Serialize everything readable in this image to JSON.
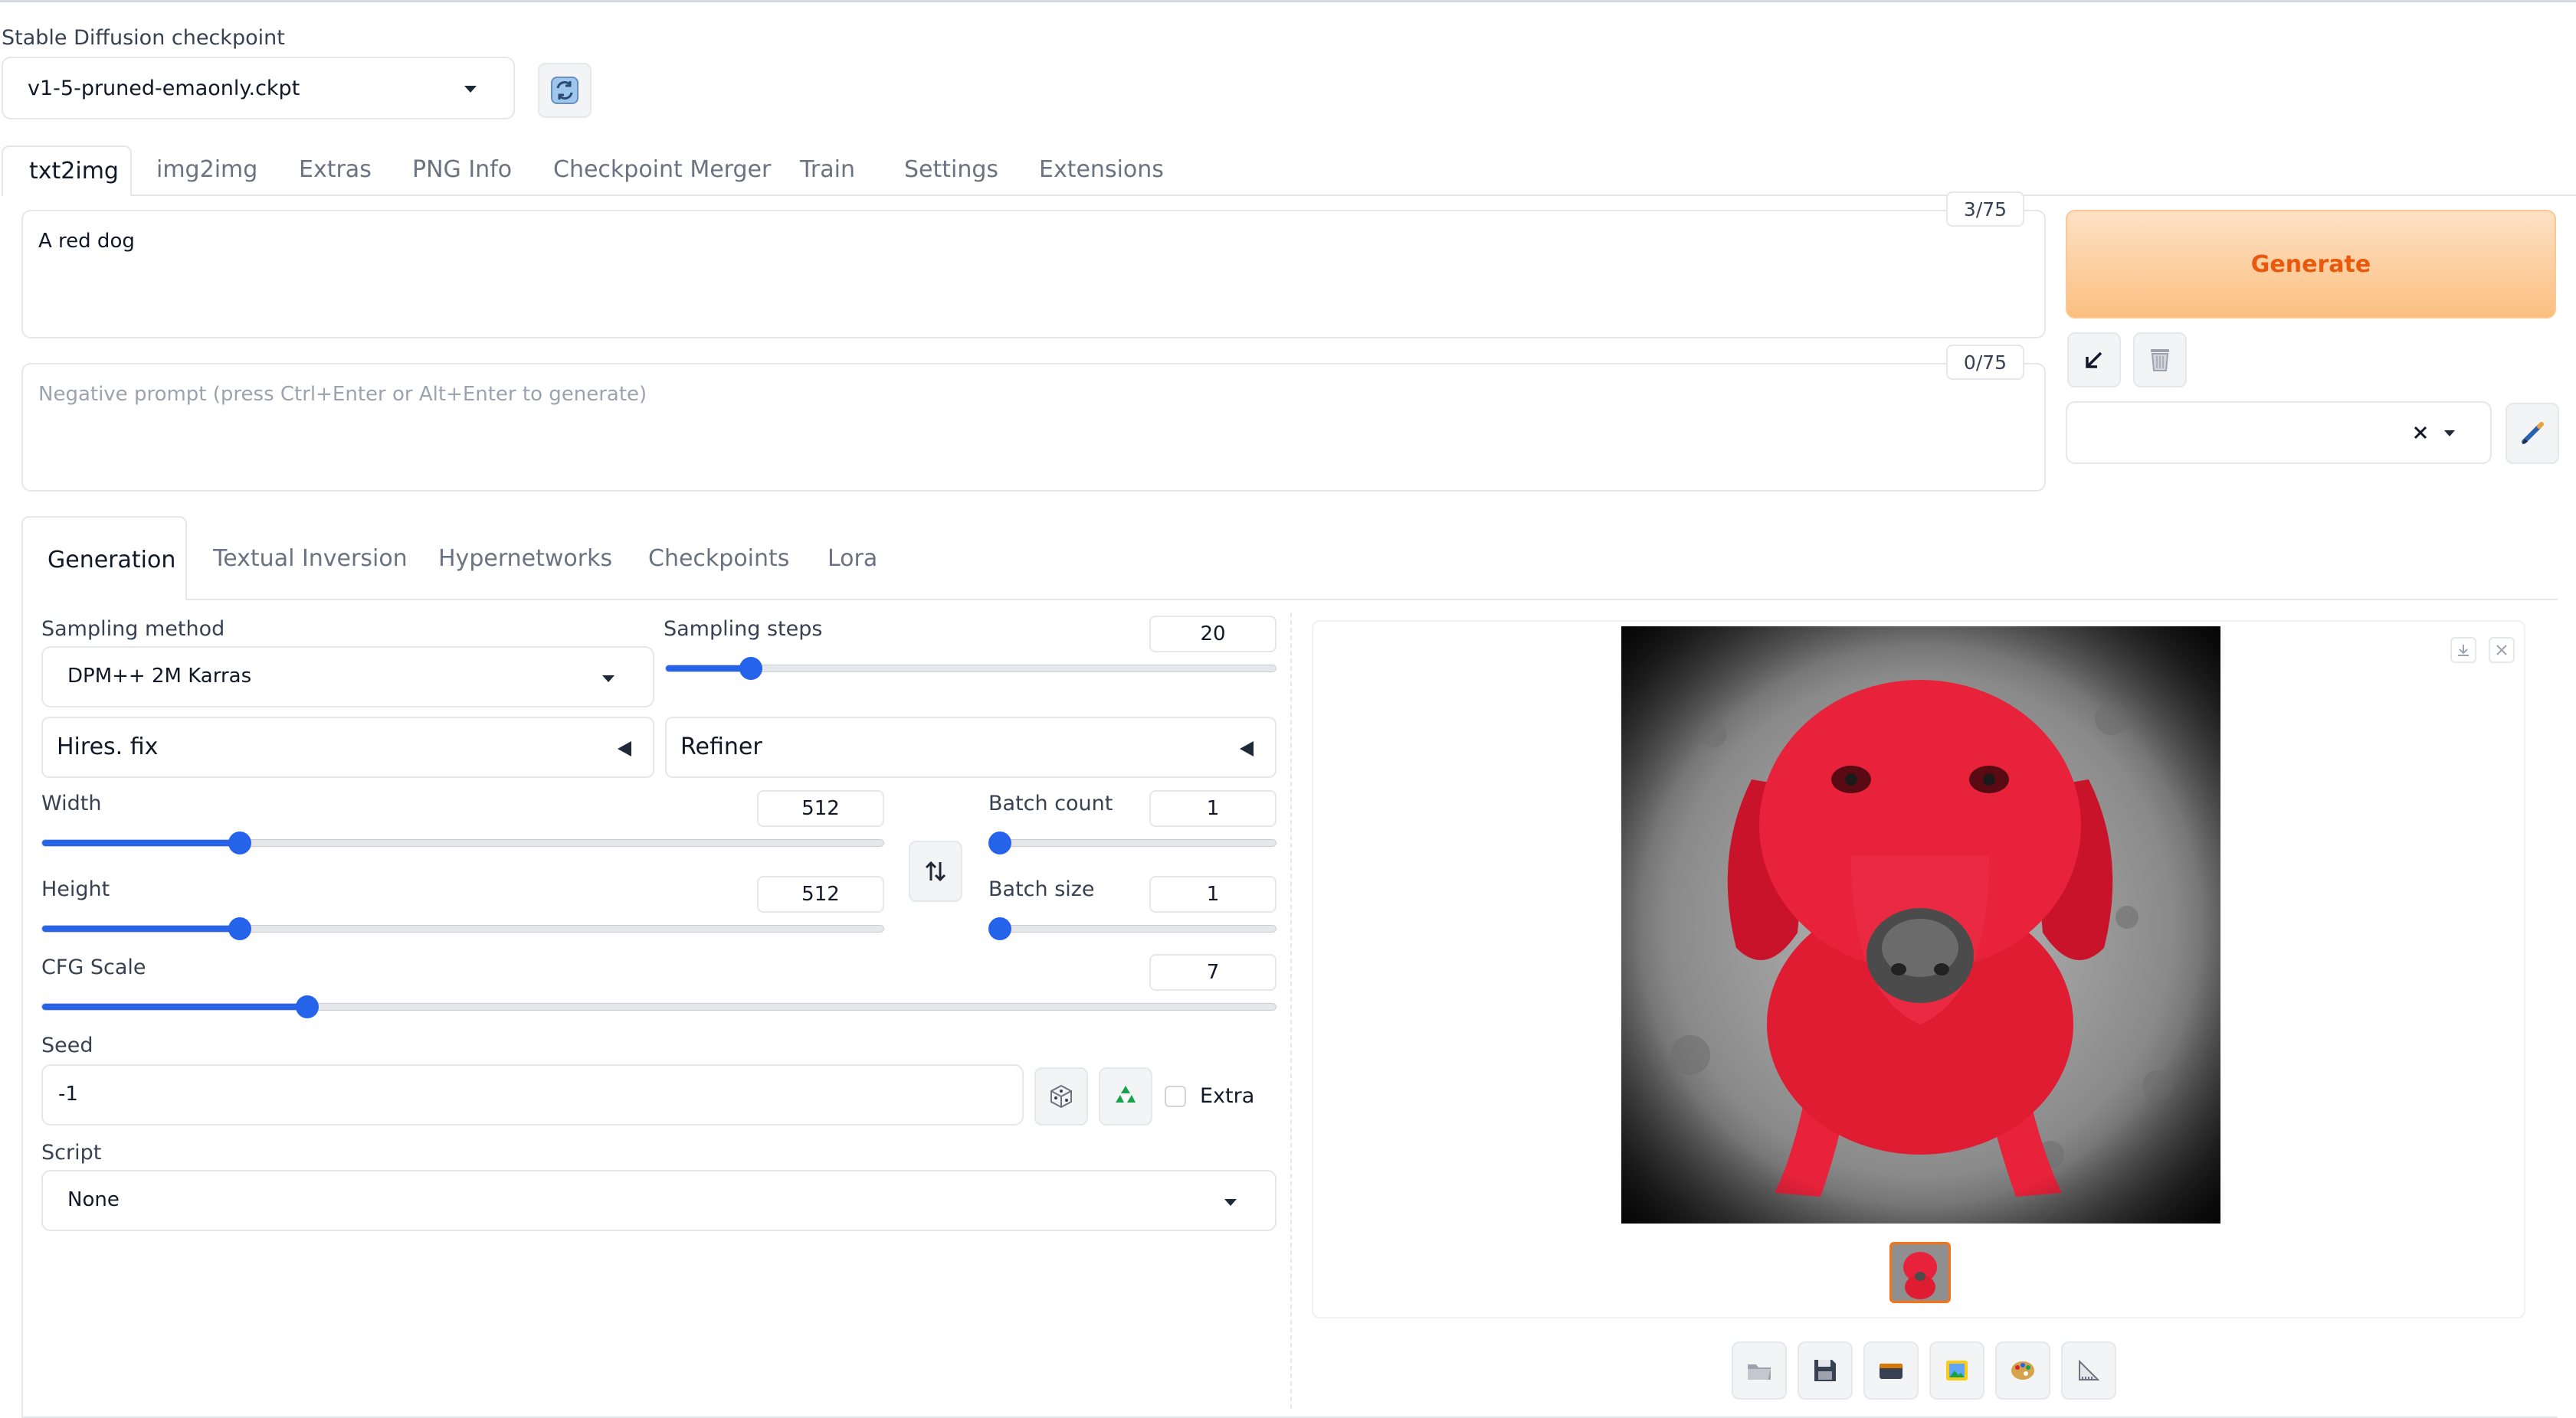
{
  "checkpoint": {
    "label": "Stable Diffusion checkpoint",
    "value": "v1-5-pruned-emaonly.ckpt"
  },
  "icons": {
    "refresh": "refresh-icon",
    "arrow_down_left": "arrow-down-left-icon",
    "trash": "trash-icon",
    "clear": "x-icon",
    "pencil": "pencil-icon",
    "swap": "swap-vertical-icon",
    "dice": "dice-icon",
    "recycle": "recycle-icon"
  },
  "main_tabs": [
    "txt2img",
    "img2img",
    "Extras",
    "PNG Info",
    "Checkpoint Merger",
    "Train",
    "Settings",
    "Extensions"
  ],
  "prompt": {
    "value": "A red dog",
    "counter": "3/75"
  },
  "negative_prompt": {
    "placeholder": "Negative prompt (press Ctrl+Enter or Alt+Enter to generate)",
    "counter": "0/75"
  },
  "generate": {
    "label": "Generate"
  },
  "sub_tabs": [
    "Generation",
    "Textual Inversion",
    "Hypernetworks",
    "Checkpoints",
    "Lora"
  ],
  "sampling_method": {
    "label": "Sampling method",
    "value": "DPM++ 2M Karras"
  },
  "sampling_steps": {
    "label": "Sampling steps",
    "value": "20",
    "fraction": 0.14
  },
  "hires_fix": {
    "label": "Hires. fix"
  },
  "refiner": {
    "label": "Refiner"
  },
  "width": {
    "label": "Width",
    "value": "512",
    "fraction": 0.235
  },
  "height": {
    "label": "Height",
    "value": "512",
    "fraction": 0.235
  },
  "batch_count": {
    "label": "Batch count",
    "value": "1",
    "fraction": 0.0
  },
  "batch_size": {
    "label": "Batch size",
    "value": "1",
    "fraction": 0.0
  },
  "cfg_scale": {
    "label": "CFG Scale",
    "value": "7",
    "fraction": 0.215
  },
  "seed": {
    "label": "Seed",
    "value": "-1",
    "extra_label": "Extra"
  },
  "script": {
    "label": "Script",
    "value": "None"
  },
  "colors": {
    "accent": "#2563eb",
    "generate_start": "#fde1c5",
    "generate_end": "#fbbf80",
    "generate_text": "#ea580c",
    "dog": "#e8223a"
  },
  "output_toolbar": [
    "folder-icon",
    "save-icon",
    "zip-icon",
    "image-icon",
    "palette-icon",
    "ruler-icon"
  ]
}
